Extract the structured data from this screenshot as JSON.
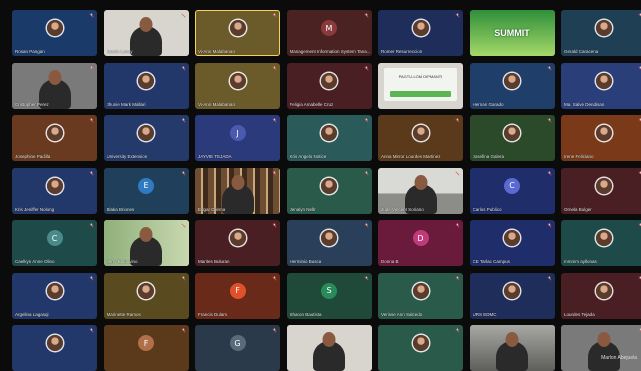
{
  "app": {
    "screen_owner_label": "Marlon Abejuela"
  },
  "participants": [
    {
      "name": "Rosan Pangan",
      "kind": "photo",
      "bg": "#1a3a6a",
      "mic": "muted"
    },
    {
      "name": "Jazzie Lacay",
      "kind": "video",
      "scene": "roomwhite",
      "mic": "muted"
    },
    {
      "name": "Vi-Ann Malabanan",
      "kind": "photo",
      "bg": "#6b5a2a",
      "mic": "muted",
      "active": true
    },
    {
      "name": "Management Information System Tana...",
      "kind": "letter",
      "letter": "M",
      "bg": "#4a2222",
      "avatar": "#8a3a3a",
      "mic": "muted"
    },
    {
      "name": "Romer Resurreccion",
      "kind": "photo",
      "bg": "#1f2d5a",
      "mic": "muted"
    },
    {
      "name": "",
      "kind": "video",
      "scene": "banner",
      "banner_text": "SUMMIT",
      "mic": "none"
    },
    {
      "name": "Gerald Caracena",
      "kind": "photo",
      "bg": "#1f3f55",
      "mic": "muted"
    },
    {
      "name": "Cristopher Perez",
      "kind": "video",
      "scene": "plain",
      "mic": "muted"
    },
    {
      "name": "Jhunie Mark Mallari",
      "kind": "photo",
      "bg": "#23386a",
      "mic": "muted"
    },
    {
      "name": "Vi-Ann Malabanan",
      "kind": "photo",
      "bg": "#6b5a2a",
      "mic": "muted"
    },
    {
      "name": "Feligia Amabelle Cruz",
      "kind": "photo",
      "bg": "#4a1f24",
      "mic": "muted"
    },
    {
      "name": "",
      "kind": "video",
      "scene": "slide",
      "slide_title": "PAGTU-LOM DIPMANTI",
      "mic": "none"
    },
    {
      "name": "Hernan Garado",
      "kind": "photo",
      "bg": "#1f3f6a",
      "mic": "muted"
    },
    {
      "name": "Ma. Salve Dendisan",
      "kind": "photo",
      "bg": "#2a3f7a",
      "mic": "muted"
    },
    {
      "name": "Josephine Padilla",
      "kind": "photo",
      "bg": "#6a3a20",
      "mic": "muted"
    },
    {
      "name": "University Extension",
      "kind": "photo",
      "bg": "#243a6a",
      "mic": "muted"
    },
    {
      "name": "JAYVIE TEJADA",
      "kind": "letter",
      "letter": "J",
      "bg": "#2a3a7a",
      "avatar": "#4a5ab0",
      "mic": "muted"
    },
    {
      "name": "Kris Angelo Notice",
      "kind": "photo",
      "bg": "#2a5a5a",
      "mic": "muted"
    },
    {
      "name": "Anna Mirror Lourdes Martinez",
      "kind": "photo",
      "bg": "#5a3a1a",
      "mic": "muted"
    },
    {
      "name": "Josefina Galera",
      "kind": "photo",
      "bg": "#2a4a2a",
      "mic": "muted"
    },
    {
      "name": "Irene Feliciano",
      "kind": "photo",
      "bg": "#7a3a1a",
      "mic": "muted"
    },
    {
      "name": "Kris Jeniffer Nolong",
      "kind": "photo",
      "bg": "#23386a",
      "mic": "muted"
    },
    {
      "name": "Blaka Briones",
      "kind": "letter",
      "letter": "E",
      "bg": "#1f3f5a",
      "avatar": "#2f7ac0",
      "mic": "muted"
    },
    {
      "name": "Edgar Dilema",
      "kind": "video",
      "scene": "shelf",
      "mic": "muted"
    },
    {
      "name": "Jenalyn Nellr",
      "kind": "photo",
      "bg": "#2a5a4a",
      "mic": "muted"
    },
    {
      "name": "Jude Vincent Soriano",
      "kind": "video",
      "scene": "office",
      "mic": "muted"
    },
    {
      "name": "Carlos Publico",
      "kind": "letter",
      "letter": "C",
      "bg": "#1f2d6a",
      "avatar": "#5a6ad0",
      "mic": "muted"
    },
    {
      "name": "Ornela Bulger",
      "kind": "photo",
      "bg": "#4a1f24",
      "mic": "muted"
    },
    {
      "name": "Caelkyn Anne Olino",
      "kind": "letter",
      "letter": "C",
      "bg": "#1f4a4a",
      "avatar": "#4a8a8a",
      "mic": "muted"
    },
    {
      "name": "Jerry Baldovino",
      "kind": "video",
      "scene": "roomgreen",
      "mic": "muted",
      "active": true
    },
    {
      "name": "Marites Buluran",
      "kind": "photo",
      "bg": "#4a1f24",
      "mic": "muted"
    },
    {
      "name": "Herminio Busca",
      "kind": "photo",
      "bg": "#2a3f5a",
      "mic": "muted"
    },
    {
      "name": "Donna B",
      "kind": "letter",
      "letter": "D",
      "bg": "#6a1a3a",
      "avatar": "#c03a7a",
      "mic": "muted"
    },
    {
      "name": "CE Tarlac Campus",
      "kind": "photo",
      "bg": "#1f2d6a",
      "mic": "muted"
    },
    {
      "name": "mmmm ayllonas",
      "kind": "photo",
      "bg": "#1f4a4a",
      "mic": "muted"
    },
    {
      "name": "Argelina Lagasqi",
      "kind": "photo",
      "bg": "#23386a",
      "mic": "muted"
    },
    {
      "name": "Marinette Ramos",
      "kind": "photo",
      "bg": "#5a4a1f",
      "mic": "muted"
    },
    {
      "name": "Francis Dulam",
      "kind": "letter",
      "letter": "F",
      "bg": "#6a2a1a",
      "avatar": "#e0502a",
      "mic": "muted"
    },
    {
      "name": "Sharon Bautista",
      "kind": "letter",
      "letter": "S",
      "bg": "#1f4a3a",
      "avatar": "#2a8a5a",
      "mic": "muted"
    },
    {
      "name": "Verisse Ann Salcedo",
      "kind": "photo",
      "bg": "#2a5a4a",
      "mic": "muted"
    },
    {
      "name": "URS EDMC",
      "kind": "photo",
      "bg": "#1f2d5a",
      "mic": "muted"
    },
    {
      "name": "Lourdes Tejada",
      "kind": "photo",
      "bg": "#4a1f24",
      "mic": "muted"
    },
    {
      "name": "",
      "kind": "photo",
      "bg": "#23386a",
      "mic": "muted"
    },
    {
      "name": "",
      "kind": "letter",
      "letter": "F",
      "bg": "#5a3a1a",
      "avatar": "#b0704a",
      "mic": "muted"
    },
    {
      "name": "",
      "kind": "letter",
      "letter": "G",
      "bg": "#2a3a4a",
      "avatar": "#5a6a7a",
      "mic": "muted"
    },
    {
      "name": "",
      "kind": "video",
      "scene": "roomwhite",
      "mic": "none"
    },
    {
      "name": "",
      "kind": "photo",
      "bg": "#2a5a4a",
      "mic": "muted"
    },
    {
      "name": "",
      "kind": "video",
      "scene": "roomtile",
      "mic": "none"
    },
    {
      "name": "",
      "kind": "video",
      "scene": "plain",
      "mic": "muted"
    }
  ],
  "colors": {
    "active_border": "#f4d25e",
    "mic_muted": "#e05050"
  }
}
